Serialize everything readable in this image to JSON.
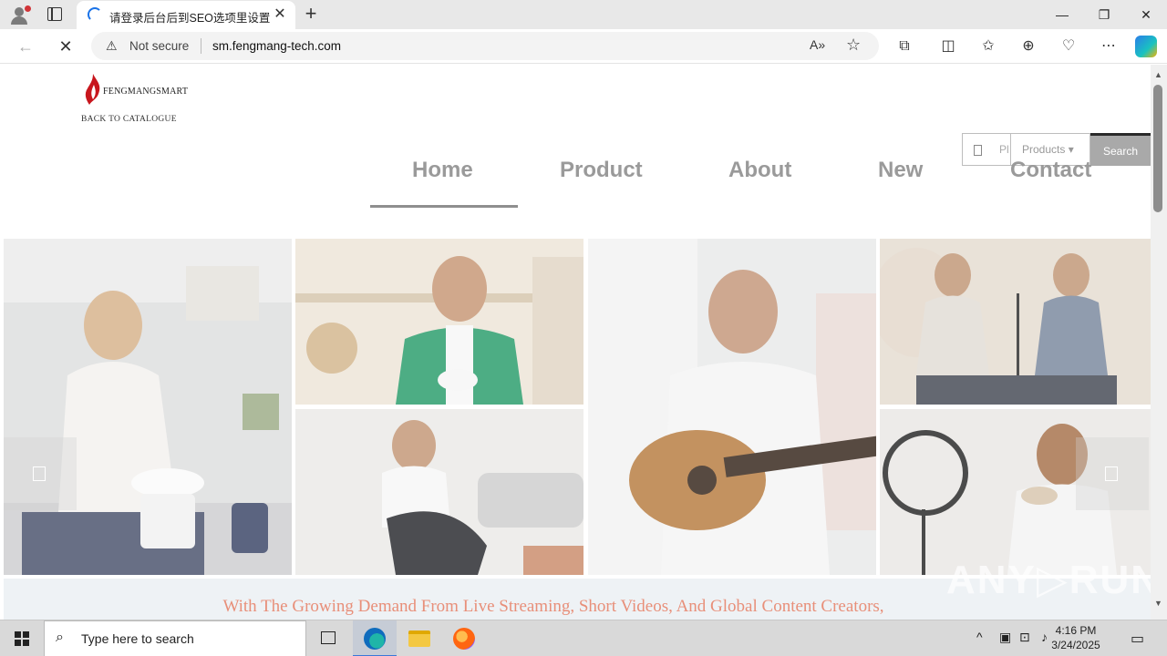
{
  "browser": {
    "tab_title": "请登录后台后到SEO选项里设置网",
    "tab_close": "✕",
    "new_tab": "+",
    "minimize": "—",
    "restore": "❐",
    "close": "✕",
    "back": "←",
    "stop": "✕",
    "security_icon": "⚠",
    "security_label": "Not secure",
    "url": "sm.fengmang-tech.com",
    "read_aloud_icon": "A»",
    "favorite_icon": "☆"
  },
  "page": {
    "logo": {
      "brand": "FENGMANGSMART",
      "back_link": "BACK TO CATALOGUE",
      "flame_color": "#c8161d"
    },
    "search": {
      "placeholder": "Pl",
      "category": "Products ▾",
      "button": "Search"
    },
    "nav": [
      "Home",
      "Product",
      "About",
      "New",
      "Contact"
    ],
    "active_nav": "Home",
    "gallery": {
      "photos": [
        "woman-cooking-photo",
        "woman-holding-cup-photo",
        "man-playing-guitar-photo",
        "two-women-vlogging-photo",
        "woman-yoga-photo",
        "woman-ring-light-photo"
      ]
    },
    "watermark": "ANY▷RUN",
    "tagline": "With The Growing Demand From Live Streaming, Short Videos, And Global Content Creators,",
    "tagline_color": "#e88f79"
  },
  "taskbar": {
    "search_placeholder": "Type here to search",
    "time": "4:16 PM",
    "date": "3/24/2025",
    "tray_icons": [
      "chevron-up-icon",
      "meet-now-icon",
      "network-icon",
      "volume-icon"
    ],
    "accent": "#3b78d8"
  }
}
